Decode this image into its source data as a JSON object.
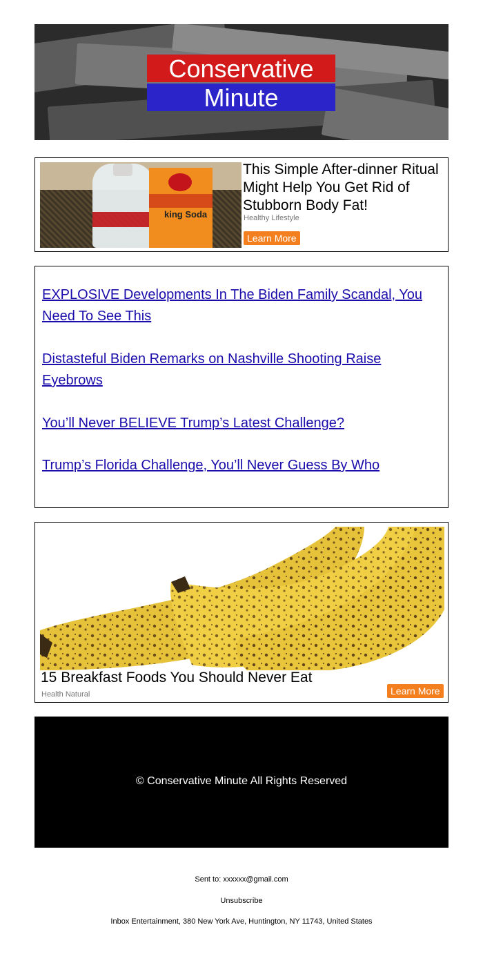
{
  "header": {
    "logo_line1": "Conservative",
    "logo_line2": "Minute",
    "logo_colors": {
      "top": "#d21a1a",
      "bottom": "#2b24c8"
    }
  },
  "ad_top": {
    "headline": "This Simple After-dinner Ritual Might Help You Get Rid of Stubborn Body Fat!",
    "source": "Healthy Lifestyle",
    "button": "Learn More",
    "image_box_text": "king Soda"
  },
  "links": [
    "EXPLOSIVE Developments In The Biden Family Scandal, You Need To See This",
    "Distasteful Biden Remarks on Nashville Shooting Raise Eyebrows",
    "You’ll Never BELIEVE Trump’s Latest Challenge?",
    "Trump’s Florida Challenge, You’ll Never Guess By Who"
  ],
  "ad_bottom": {
    "headline": "15 Breakfast Foods You Should Never Eat",
    "source": "Health Natural",
    "button": "Learn More"
  },
  "footer": {
    "copyright": "© Conservative Minute All Rights Reserved"
  },
  "meta": {
    "sent_label": "Sent to:",
    "sent_email": "xxxxxx@gmail.com",
    "unsubscribe": "Unsubscribe",
    "address": "Inbox Entertainment, 380 New York Ave, Huntington, NY 11743, United States"
  },
  "accent_color": "#f37f1f",
  "link_color": "#1a0dab"
}
